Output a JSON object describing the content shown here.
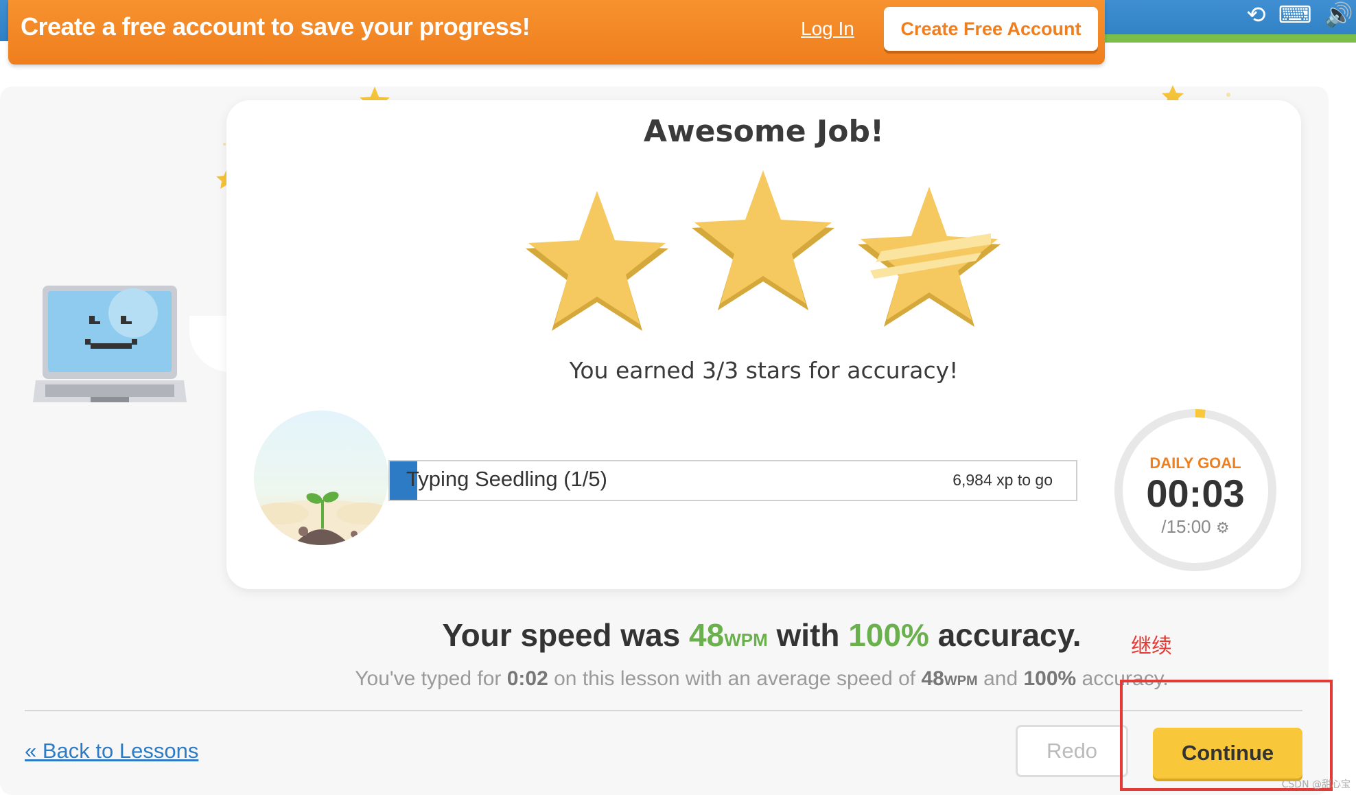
{
  "banner": {
    "message": "Create a free account to save your progress!",
    "login_label": "Log In",
    "create_label": "Create Free Account"
  },
  "card": {
    "title": "Awesome Job!",
    "stars_earned": 3,
    "stars_total": 3,
    "accuracy_message": "You earned 3/3 stars for accuracy!",
    "level_label": "Typing Seedling (1/5)",
    "xp_to_go": "6,984 xp to go",
    "xp_progress_fraction": 0.04
  },
  "daily_goal": {
    "label": "DAILY GOAL",
    "time": "00:03",
    "total": "/15:00",
    "progress_fraction": 0.0033
  },
  "result": {
    "speed_prefix": "Your speed was ",
    "speed_value": "48",
    "speed_unit": "WPM",
    "with_text": " with ",
    "accuracy_value": "100%",
    "accuracy_suffix": " accuracy."
  },
  "summary": {
    "prefix": "You've typed for ",
    "time": "0:02",
    "mid": " on this lesson with an average speed of ",
    "speed_value": "48",
    "speed_unit": "WPM",
    "and_text": " and ",
    "accuracy_value": "100%",
    "suffix": " accuracy."
  },
  "footer": {
    "back_label": "« Back to Lessons",
    "redo_label": "Redo",
    "continue_label": "Continue"
  },
  "annotation": {
    "text": "继续"
  },
  "watermark": "CSDN @甜心宝",
  "colors": {
    "banner_orange": "#f07e1d",
    "accent_green": "#6ab04c",
    "link_blue": "#2d7bc4",
    "continue_yellow": "#f8c83a",
    "annotation_red": "#e53935"
  },
  "icons": [
    "history-icon",
    "keyboard-off-icon",
    "speaker-icon",
    "gear-icon"
  ]
}
